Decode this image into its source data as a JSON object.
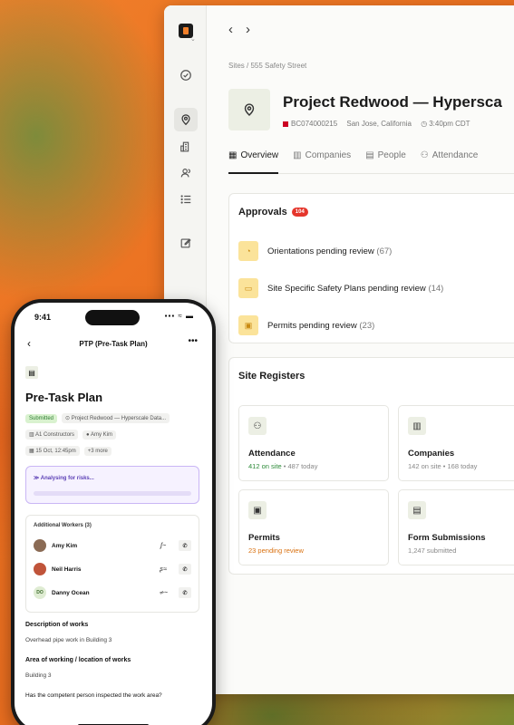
{
  "desktop": {
    "nav": {
      "back": "‹",
      "forward": "›"
    },
    "breadcrumb": "Sites  /  555 Safety Street",
    "project": {
      "title": "Project Redwood — Hypersca",
      "code": "BC074000215",
      "location": "San Jose, California",
      "time": "3:40pm CDT"
    },
    "tabs": [
      {
        "label": "Overview",
        "icon": "grid-icon"
      },
      {
        "label": "Companies",
        "icon": "building-icon"
      },
      {
        "label": "People",
        "icon": "id-card-icon"
      },
      {
        "label": "Attendance",
        "icon": "people-icon"
      }
    ],
    "approvals": {
      "title": "Approvals",
      "badge": "104",
      "items": [
        {
          "label": "Orientations pending review",
          "count": "(67)"
        },
        {
          "label": "Site Specific Safety Plans pending review",
          "count": "(14)"
        },
        {
          "label": "Permits pending review",
          "count": "(23)"
        }
      ]
    },
    "registers": {
      "title": "Site Registers",
      "items": [
        {
          "title": "Attendance",
          "highlight": "412 on site",
          "rest": " • 487 today",
          "tone": "green"
        },
        {
          "title": "Companies",
          "highlight": "",
          "rest": "142 on site • 168 today",
          "tone": "none"
        },
        {
          "title": "Permits",
          "highlight": "23 pending review",
          "rest": "",
          "tone": "orange"
        },
        {
          "title": "Form Submissions",
          "highlight": "",
          "rest": "1,247 submitted",
          "tone": "none"
        }
      ]
    }
  },
  "phone": {
    "time": "9:41",
    "status_icons": "▪▪▪ ≈ ▬",
    "header_title": "PTP (Pre-Task Plan)",
    "back": "‹",
    "more": "•••",
    "title": "Pre-Task Plan",
    "status": "Submitted",
    "project": "Project Redwood — Hyperscale Data...",
    "company": "A1 Constructors",
    "user": "Amy Kim",
    "date": "15 Oct, 12:45pm",
    "more_tag": "+3 more",
    "analysing": "Analysing for risks...",
    "workers_title": "Additional Workers (3)",
    "workers": [
      {
        "name": "Amy Kim",
        "initials": ""
      },
      {
        "name": "Neil Harris",
        "initials": ""
      },
      {
        "name": "Danny Ocean",
        "initials": "DO"
      }
    ],
    "desc_label": "Description of works",
    "desc_value": "Overhead pipe work in Building 3",
    "area_label": "Area of working / location of works",
    "area_value": "Building 3",
    "question": "Has the competent person inspected the work area?"
  }
}
